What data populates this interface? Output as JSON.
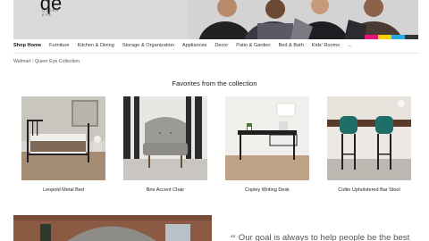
{
  "hero": {
    "logo_text": "qe",
    "logo_sub": "QUEER EYE",
    "stripe_colors": [
      "#e8127a",
      "#f5d100",
      "#2aa7e0",
      "#333333"
    ]
  },
  "nav": {
    "items": [
      {
        "label": "Shop Home",
        "active": true
      },
      {
        "label": "Furniture"
      },
      {
        "label": "Kitchen & Dining"
      },
      {
        "label": "Storage & Organization"
      },
      {
        "label": "Appliances"
      },
      {
        "label": "Decor"
      },
      {
        "label": "Patio & Garden"
      },
      {
        "label": "Bed & Bath"
      },
      {
        "label": "Kids' Rooms"
      },
      {
        "label": "..."
      }
    ]
  },
  "breadcrumb": {
    "root": "Walmart",
    "separator": "/",
    "current": "Queer Eye Collection"
  },
  "section": {
    "title": "Favorites from the collection"
  },
  "products": [
    {
      "name": "Leopold Metal Bed"
    },
    {
      "name": "Brie Accent Chair"
    },
    {
      "name": "Copley Writing Desk"
    },
    {
      "name": "Coltin Upholstered Bar Stool"
    }
  ],
  "quote": {
    "mark": "“",
    "text": "Our goal is always to help people be the best"
  },
  "colors": {
    "accent_pink": "#e8127a",
    "accent_yellow": "#f5d100",
    "accent_blue": "#2aa7e0"
  }
}
